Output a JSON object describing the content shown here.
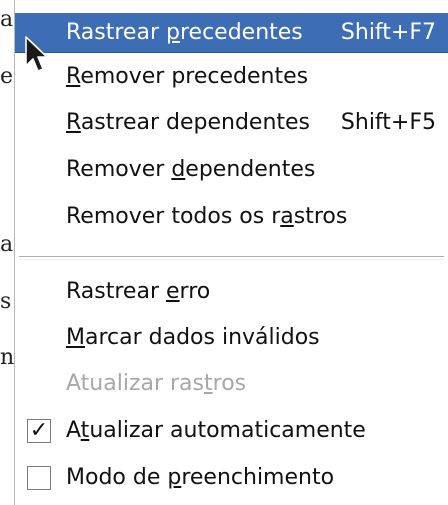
{
  "background_letters": [
    "a",
    "e",
    "a",
    "s",
    "n"
  ],
  "menu": {
    "items": [
      {
        "pre": "Rastrear ",
        "mn": "p",
        "post": "recedentes",
        "shortcut": "Shift+F7",
        "highlighted": true
      },
      {
        "pre": "",
        "mn": "R",
        "post": "emover precedentes",
        "shortcut": ""
      },
      {
        "pre": "",
        "mn": "R",
        "post": "astrear dependentes",
        "shortcut": "Shift+F5"
      },
      {
        "pre": "Remover ",
        "mn": "d",
        "post": "ependentes",
        "shortcut": ""
      },
      {
        "pre": "Remover todos os r",
        "mn": "a",
        "post": "stros",
        "shortcut": ""
      },
      {
        "pre": "Rastrear ",
        "mn": "e",
        "post": "rro",
        "shortcut": ""
      },
      {
        "pre": "",
        "mn": "M",
        "post": "arcar dados inválidos",
        "shortcut": ""
      },
      {
        "pre": "Atualizar ras",
        "mn": "t",
        "post": "ros",
        "shortcut": "",
        "disabled": true
      },
      {
        "pre": "A",
        "mn": "t",
        "post": "ualizar automaticamente",
        "checked": true,
        "check_mark": "✓"
      },
      {
        "pre": "Modo de ",
        "mn": "p",
        "post": "reenchimento",
        "checked": false,
        "check_mark": ""
      }
    ]
  },
  "colors": {
    "highlight": "#3d6db5",
    "disabled_text": "#a8a8a8"
  }
}
